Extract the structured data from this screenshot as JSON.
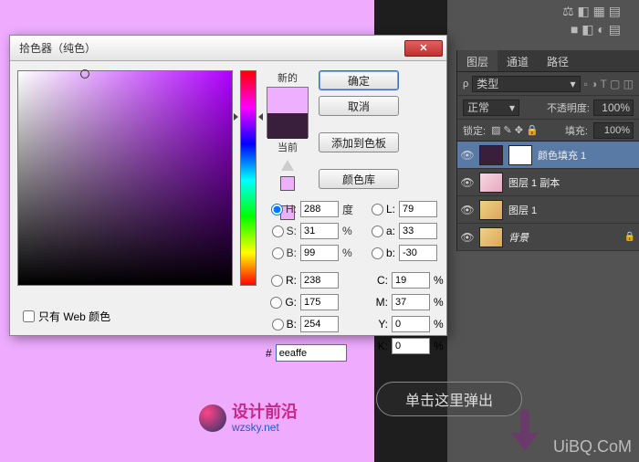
{
  "dialog": {
    "title": "拾色器（纯色）",
    "new_label": "新的",
    "current_label": "当前",
    "buttons": {
      "ok": "确定",
      "cancel": "取消",
      "add_swatch": "添加到色板",
      "color_lib": "颜色库"
    },
    "hsb": {
      "h": "288",
      "s": "31",
      "b": "99",
      "h_unit": "度",
      "pct": "%"
    },
    "lab": {
      "l": "79",
      "a": "33",
      "b": "-30"
    },
    "rgb": {
      "r": "238",
      "g": "175",
      "b": "254"
    },
    "cmyk": {
      "c": "19",
      "m": "37",
      "y": "0",
      "k": "0",
      "pct": "%"
    },
    "hex": "eeaffe",
    "labels": {
      "H": "H:",
      "S": "S:",
      "B": "B:",
      "L": "L:",
      "a": "a:",
      "b": "b:",
      "R": "R:",
      "G": "G:",
      "Bb": "B:",
      "C": "C:",
      "M": "M:",
      "Y": "Y:",
      "K": "K:",
      "hash": "#"
    },
    "web_only": "只有 Web 颜色"
  },
  "panel": {
    "tabs": {
      "layers": "图层",
      "channels": "通道",
      "paths": "路径"
    },
    "type_label": "类型",
    "blend_mode": "正常",
    "opacity_label": "不透明度:",
    "opacity_val": "100%",
    "lock_label": "锁定:",
    "fill_label": "填充:",
    "fill_val": "100%",
    "layers": [
      {
        "name": "颜色填充 1",
        "selected": true,
        "has_mask": true
      },
      {
        "name": "图层 1 副本",
        "selected": false
      },
      {
        "name": "图层 1",
        "selected": false
      },
      {
        "name": "背景",
        "selected": false,
        "locked": true
      }
    ]
  },
  "annotation": "单击这里弹出",
  "logo": {
    "cn": "设计前沿",
    "en": "wzsky.net"
  },
  "watermark": "UiBQ.CoM"
}
